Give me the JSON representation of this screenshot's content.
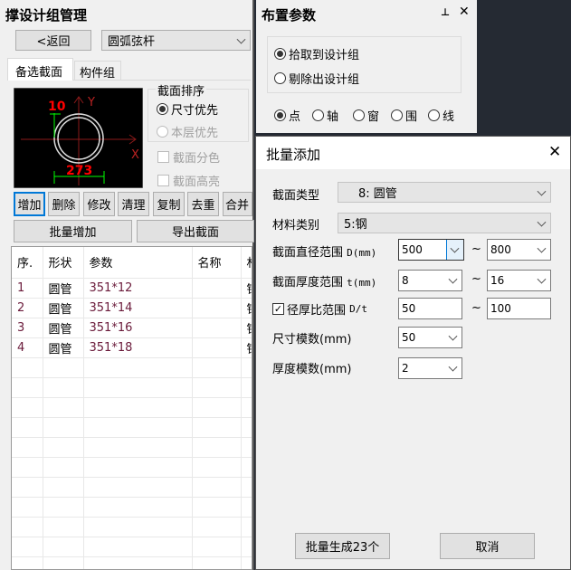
{
  "left": {
    "title": "撑设计组管理",
    "back": "<返回",
    "type_select": "圆弧弦杆",
    "tabs": [
      "备选截面",
      "构件组"
    ],
    "preview": {
      "dim_top": "10",
      "dim_bottom": "273",
      "axis_y": "Y",
      "axis_x": "X"
    },
    "sort_group": {
      "title": "截面排序",
      "options": [
        {
          "label": "尺寸优先",
          "checked": true,
          "enabled": true
        },
        {
          "label": "本层优先",
          "checked": false,
          "enabled": false
        }
      ]
    },
    "checkboxes": [
      "截面分色",
      "截面高亮"
    ],
    "buttons": [
      "增加",
      "删除",
      "修改",
      "清理",
      "复制",
      "去重",
      "合并"
    ],
    "batch_add": "批量增加",
    "export": "导出截面",
    "table": {
      "columns": [
        "序.",
        "形状",
        "参数",
        "名称",
        "材"
      ],
      "rows": [
        [
          "1",
          "圆管",
          "351*12",
          "",
          "钢"
        ],
        [
          "2",
          "圆管",
          "351*14",
          "",
          "钢"
        ],
        [
          "3",
          "圆管",
          "351*16",
          "",
          "钢"
        ],
        [
          "4",
          "圆管",
          "351*18",
          "",
          "钢"
        ]
      ]
    }
  },
  "layout_params": {
    "title": "布置参数",
    "mode": [
      {
        "label": "拾取到设计组",
        "checked": true
      },
      {
        "label": "剔除出设计组",
        "checked": false
      }
    ],
    "pick": [
      {
        "label": "点",
        "checked": true
      },
      {
        "label": "轴",
        "checked": false
      },
      {
        "label": "窗",
        "checked": false
      },
      {
        "label": "围",
        "checked": false
      },
      {
        "label": "线",
        "checked": false
      }
    ]
  },
  "dialog": {
    "title": "批量添加",
    "section_type": {
      "label": "截面类型",
      "value": "8:  圆管"
    },
    "material": {
      "label": "材料类别",
      "value": "5:钢"
    },
    "diameter": {
      "label": "截面直径范围",
      "unit": "D(mm)",
      "from": "500",
      "to": "800"
    },
    "thickness": {
      "label": "截面厚度范围",
      "unit": "t(mm)",
      "from": "8",
      "to": "16"
    },
    "ratio": {
      "label": "径厚比范围",
      "unit": "D/t",
      "checked": true,
      "from": "50",
      "to": "100"
    },
    "size_modulus": {
      "label": "尺寸模数(mm)",
      "value": "50"
    },
    "thick_modulus": {
      "label": "厚度模数(mm)",
      "value": "2"
    },
    "tilde": "~",
    "generate": "批量生成23个",
    "cancel": "取消"
  }
}
